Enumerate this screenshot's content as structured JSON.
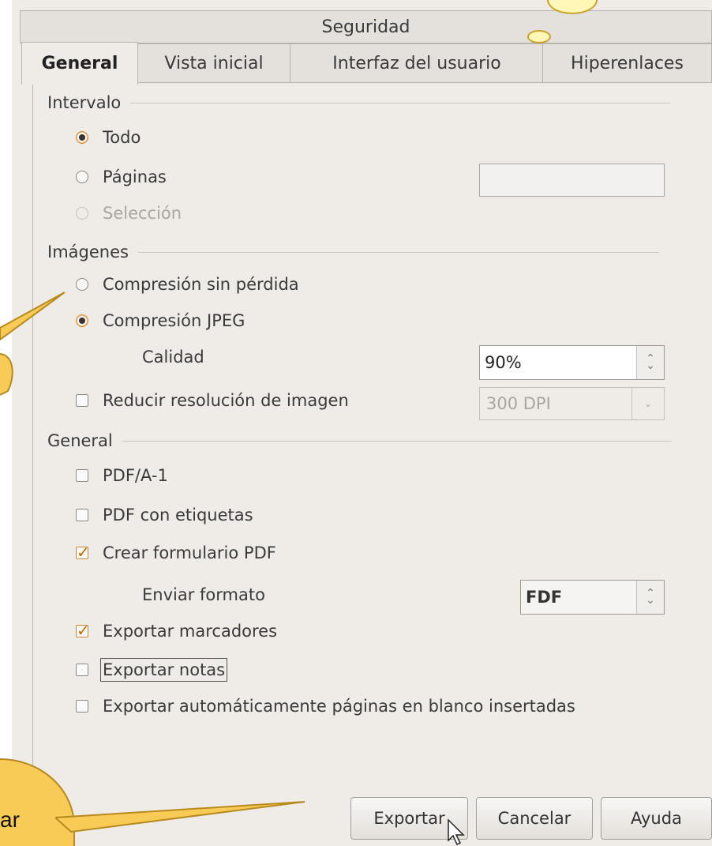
{
  "tabs": {
    "back": "Seguridad",
    "general": "General",
    "vista_inicial": "Vista inicial",
    "interfaz": "Interfaz del usuario",
    "hiperenlaces": "Hiperenlaces"
  },
  "intervalo": {
    "title": "Intervalo",
    "todo": "Todo",
    "paginas": "Páginas",
    "seleccion": "Selección",
    "paginas_value": ""
  },
  "imagenes": {
    "title": "Imágenes",
    "sin_perdida": "Compresión sin pérdida",
    "jpeg": "Compresión JPEG",
    "calidad_label": "Calidad",
    "calidad_value": "90%",
    "reducir": "Reducir resolución de imagen",
    "dpi_value": "300 DPI"
  },
  "general": {
    "title": "General",
    "pdfa": "PDF/A-1",
    "etiquetas": "PDF con etiquetas",
    "formulario": "Crear formulario PDF",
    "enviar_label": "Enviar formato",
    "enviar_value": "FDF",
    "marcadores": "Exportar marcadores",
    "notas": "Exportar notas",
    "blanco": "Exportar automáticamente páginas en blanco insertadas"
  },
  "buttons": {
    "exportar": "Exportar",
    "cancelar": "Cancelar",
    "ayuda": "Ayuda"
  },
  "callout_text": "ar",
  "colors": {
    "callout": "#f8cb57",
    "dialog_bg": "#efebe7",
    "accent": "#d88a35"
  }
}
